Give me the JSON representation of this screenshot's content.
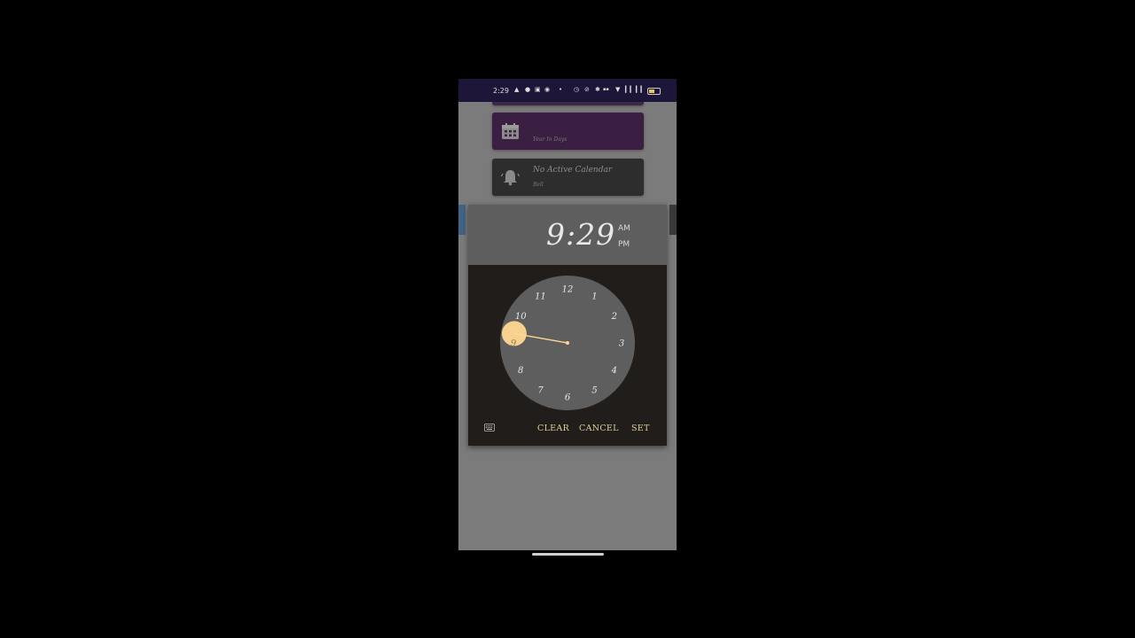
{
  "status_bar": {
    "time": "2:29",
    "icons": [
      "bell-icon",
      "chat-icon",
      "instagram-icon",
      "whatsapp-icon",
      "dot-icon",
      "alarm-icon",
      "mute-icon",
      "bluetooth-icon",
      "data-icon",
      "wifi-icon",
      "signal-icon",
      "battery-icon"
    ]
  },
  "background": {
    "card_purple": {
      "title": "",
      "subtitle": "Year In Days",
      "color": "#3a1f42"
    },
    "card_dark": {
      "title": "No Active Calendar",
      "subtitle": "Bell",
      "color": "#2d2d2e"
    }
  },
  "time_picker": {
    "hour": "9",
    "separator": ":",
    "minute": "29",
    "am_label": "AM",
    "pm_label": "PM",
    "selected_period": "AM",
    "selected_hour": 9,
    "clock_numbers": [
      "12",
      "1",
      "2",
      "3",
      "4",
      "5",
      "6",
      "7",
      "8",
      "9",
      "10",
      "11"
    ],
    "accent_color": "#ffd890",
    "actions": {
      "keyboard_icon": "keyboard-icon",
      "clear": "CLEAR",
      "cancel": "CANCEL",
      "set": "SET"
    }
  }
}
